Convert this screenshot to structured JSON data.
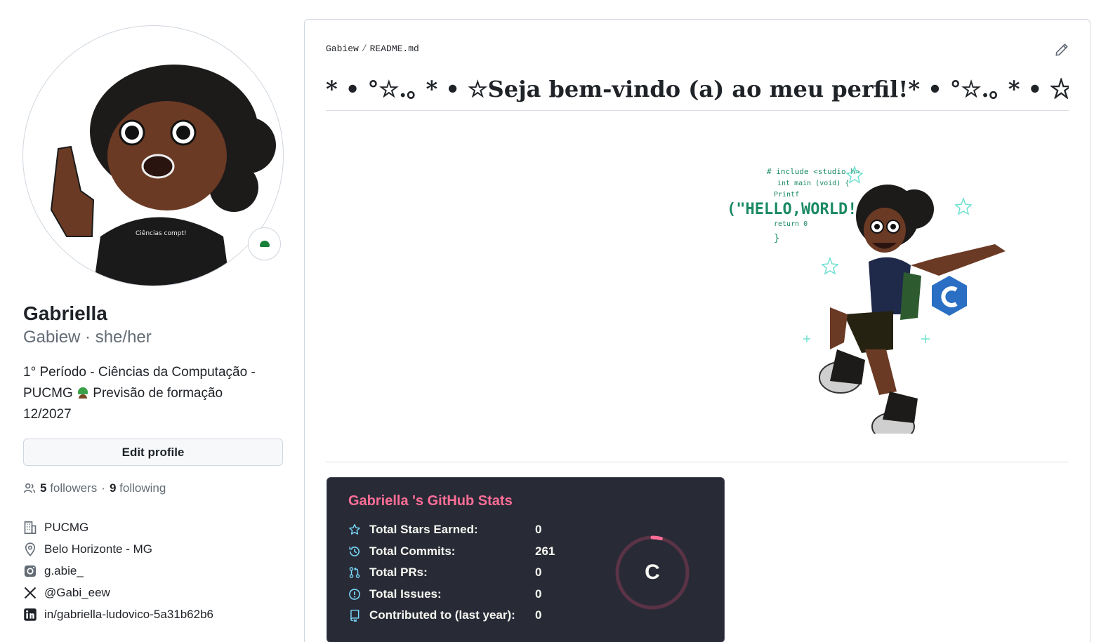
{
  "profile": {
    "name": "Gabriella",
    "login": "Gabiew",
    "pronouns": "she/her",
    "login_line": "Gabiew · she/her",
    "bio_line1": "1° Período - Ciências da Computação -",
    "bio_line2_a": "PUCMG",
    "bio_line2_b": "Previsão de formação",
    "bio_line3": "12/2027",
    "edit_label": "Edit profile",
    "followers_count": "5",
    "followers_label": "followers",
    "following_count": "9",
    "following_label": "following",
    "company": "PUCMG",
    "location": "Belo Horizonte - MG",
    "instagram": "g.abie_",
    "twitter": "@Gabi_eew",
    "linkedin": "in/gabriella-ludovico-5a31b62b6",
    "avatar_text": "Ciências compt!"
  },
  "readme": {
    "owner": "Gabiew",
    "separator": "/",
    "file": "README.md",
    "title": "* • °☆.｡ * • ☆Seja bem-vindo (a) ao meu perfil!* • °☆.｡ * • ☆",
    "illustration_code": [
      "# include <studio.h>",
      "int main (void) {",
      "Printf",
      "(\"HELLO,WORLD!\");",
      "return 0",
      "}"
    ]
  },
  "stats_card": {
    "title": "Gabriella 's GitHub Stats",
    "grade": "C",
    "grade_progress": 0.04,
    "rows": [
      {
        "label": "Total Stars Earned:",
        "value": "0",
        "icon": "star-icon"
      },
      {
        "label": "Total Commits:",
        "value": "261",
        "icon": "history-icon"
      },
      {
        "label": "Total PRs:",
        "value": "0",
        "icon": "pull-request-icon"
      },
      {
        "label": "Total Issues:",
        "value": "0",
        "icon": "issue-icon"
      },
      {
        "label": "Contributed to (last year):",
        "value": "0",
        "icon": "repo-icon"
      }
    ]
  },
  "colors": {
    "card_bg": "#282a36",
    "card_title": "#ff6e96",
    "card_icon": "#79dafa",
    "ring_track": "#5a3346",
    "ring_fill": "#ff6e96"
  }
}
